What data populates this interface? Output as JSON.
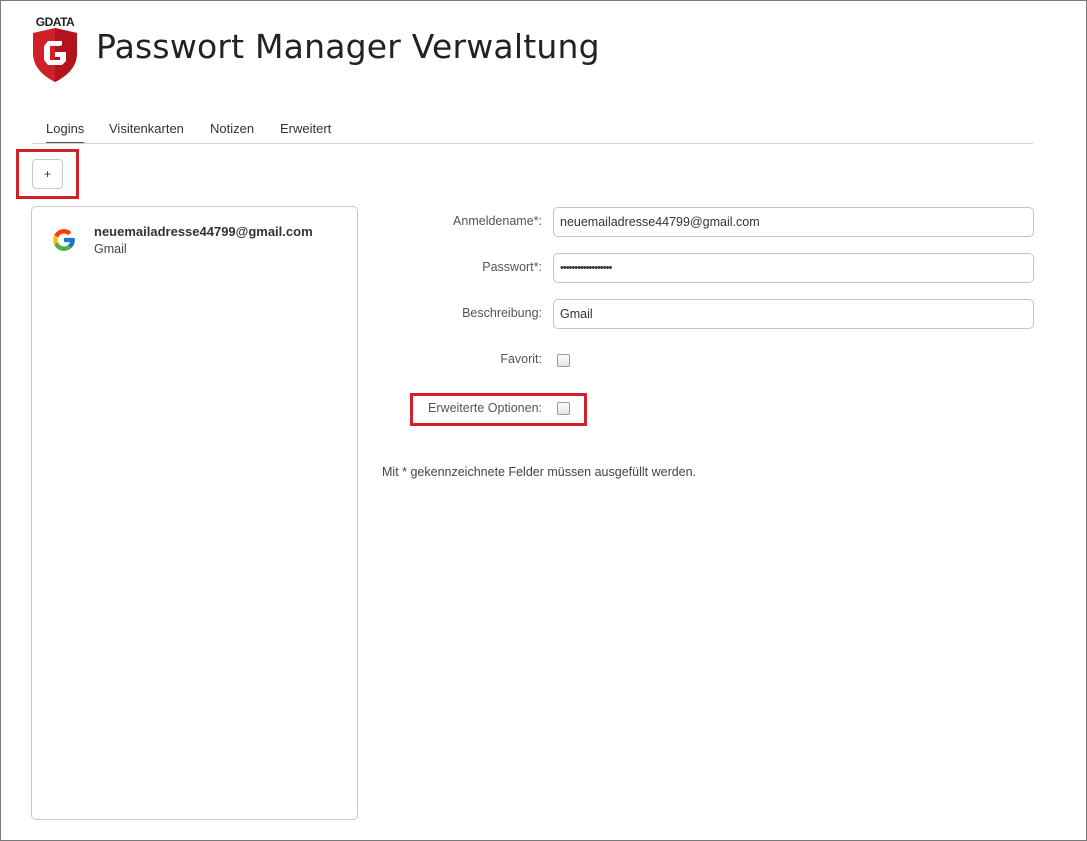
{
  "app": {
    "brand_text": "GDATA",
    "title": "Passwort Manager Verwaltung"
  },
  "tabs": [
    {
      "label": "Logins",
      "active": true
    },
    {
      "label": "Visitenkarten",
      "active": false
    },
    {
      "label": "Notizen",
      "active": false
    },
    {
      "label": "Erweitert",
      "active": false
    }
  ],
  "toolbar": {
    "add_label": "+"
  },
  "list": {
    "items": [
      {
        "icon": "google-icon",
        "title": "neuemailadresse44799@gmail.com",
        "subtitle": "Gmail"
      }
    ]
  },
  "form": {
    "username_label": "Anmeldename*:",
    "username_value": "neuemailadresse44799@gmail.com",
    "password_label": "Passwort*:",
    "password_value": "••••••••••••••••••",
    "description_label": "Beschreibung:",
    "description_value": "Gmail",
    "favorite_label": "Favorit:",
    "favorite_checked": false,
    "advanced_label": "Erweiterte Optionen:",
    "advanced_checked": false,
    "required_note": "Mit * gekennzeichnete Felder müssen ausgefüllt werden."
  },
  "colors": {
    "highlight": "#d0202a",
    "brand_red": "#d0202a"
  }
}
